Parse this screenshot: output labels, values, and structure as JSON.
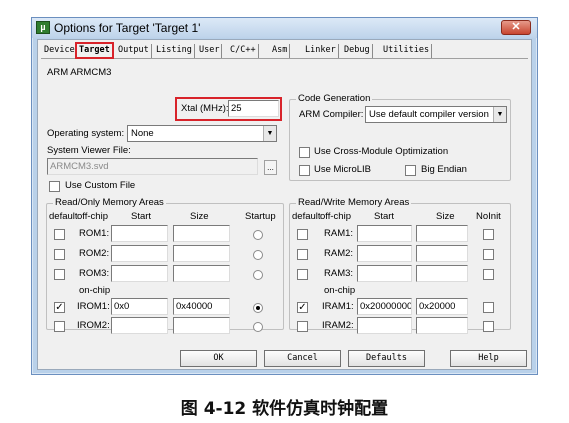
{
  "window": {
    "title": "Options for Target 'Target 1'",
    "close": "✕"
  },
  "tabs": [
    "Device",
    "Target",
    "Output",
    "Listing",
    "User",
    "C/C++",
    "Asm",
    "Linker",
    "Debug",
    "Utilities"
  ],
  "target": {
    "device_name": "ARM ARMCM3",
    "xtal_label": "Xtal (MHz):",
    "xtal_value": "25",
    "os_label": "Operating system:",
    "os_value": "None",
    "svf_label": "System Viewer File:",
    "svf_value": "ARMCM3.svd",
    "svf_browse": "...",
    "use_custom_file": "Use Custom File",
    "code_gen": {
      "title": "Code Generation",
      "compiler_label": "ARM Compiler:",
      "compiler_value": "Use default compiler version",
      "cross_module": "Use Cross-Module Optimization",
      "microlib": "Use MicroLIB",
      "big_endian": "Big Endian"
    },
    "rom": {
      "title": "Read/Only Memory Areas",
      "headers": {
        "default": "default",
        "offchip": "off-chip",
        "start": "Start",
        "size": "Size",
        "startup": "Startup"
      },
      "onchip_label": "on-chip",
      "rows": [
        {
          "name": "ROM1:",
          "start": "",
          "size": "",
          "default": false,
          "startup": false
        },
        {
          "name": "ROM2:",
          "start": "",
          "size": "",
          "default": false,
          "startup": false
        },
        {
          "name": "ROM3:",
          "start": "",
          "size": "",
          "default": false,
          "startup": false
        },
        {
          "name": "IROM1:",
          "start": "0x0",
          "size": "0x40000",
          "default": true,
          "startup": true
        },
        {
          "name": "IROM2:",
          "start": "",
          "size": "",
          "default": false,
          "startup": false
        }
      ]
    },
    "ram": {
      "title": "Read/Write Memory Areas",
      "headers": {
        "default": "default",
        "offchip": "off-chip",
        "start": "Start",
        "size": "Size",
        "noinit": "NoInit"
      },
      "onchip_label": "on-chip",
      "rows": [
        {
          "name": "RAM1:",
          "start": "",
          "size": "",
          "default": false,
          "noinit": false
        },
        {
          "name": "RAM2:",
          "start": "",
          "size": "",
          "default": false,
          "noinit": false
        },
        {
          "name": "RAM3:",
          "start": "",
          "size": "",
          "default": false,
          "noinit": false
        },
        {
          "name": "IRAM1:",
          "start": "0x20000000",
          "size": "0x20000",
          "default": true,
          "noinit": false
        },
        {
          "name": "IRAM2:",
          "start": "",
          "size": "",
          "default": false,
          "noinit": false
        }
      ]
    }
  },
  "buttons": {
    "ok": "OK",
    "cancel": "Cancel",
    "defaults": "Defaults",
    "help": "Help"
  },
  "caption": "图 4-12 软件仿真时钟配置"
}
